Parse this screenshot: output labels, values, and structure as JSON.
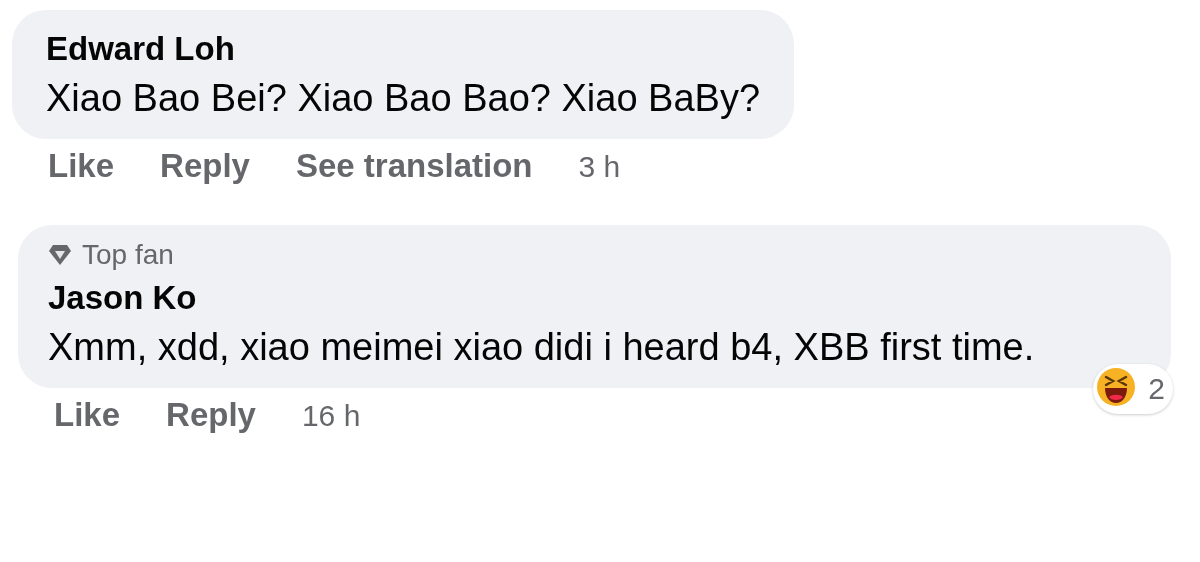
{
  "comments": [
    {
      "author": "Edward Loh",
      "text": "Xiao Bao Bei? Xiao Bao Bao? Xiao BaBy?",
      "actions": [
        "Like",
        "Reply",
        "See translation"
      ],
      "time": "3 h"
    },
    {
      "badge": "Top fan",
      "author": "Jason Ko",
      "text": "Xmm, xdd, xiao meimei xiao didi i heard b4, XBB first time.",
      "actions": [
        "Like",
        "Reply"
      ],
      "time": "16 h",
      "reactions": {
        "count": "2"
      }
    }
  ]
}
